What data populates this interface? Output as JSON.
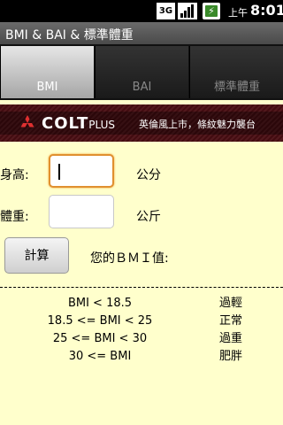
{
  "status_bar": {
    "network": "3G",
    "am_pm": "上午",
    "time": "8:01",
    "icons": [
      "3g-icon",
      "signal-icon",
      "battery-charging-icon"
    ]
  },
  "app": {
    "title": "BMI & BAI & 標準體重"
  },
  "tabs": [
    {
      "label": "BMI",
      "active": true
    },
    {
      "label": "BAI",
      "active": false
    },
    {
      "label": "標準體重",
      "active": false
    }
  ],
  "banner": {
    "brand": "COLT",
    "brand_suffix": "PLUS",
    "slogan": "英倫風上市，條紋魅力襲台"
  },
  "form": {
    "height_label": "身高:",
    "height_value": "",
    "height_unit": "公分",
    "weight_label": "體重:",
    "weight_value": "",
    "weight_unit": "公斤",
    "calc_label": "計算",
    "result_label": "您的ＢＭＩ值:"
  },
  "bmi_table": [
    {
      "range": "BMI < 18.5",
      "class": "過輕"
    },
    {
      "range": "18.5 <= BMI < 25",
      "class": "正常"
    },
    {
      "range": "25 <= BMI < 30",
      "class": "過重"
    },
    {
      "range": "30 <= BMI",
      "class": "肥胖"
    }
  ],
  "colors": {
    "background": "#ffffcc",
    "focus_ring": "#e09030",
    "banner": "#4a0d12"
  }
}
